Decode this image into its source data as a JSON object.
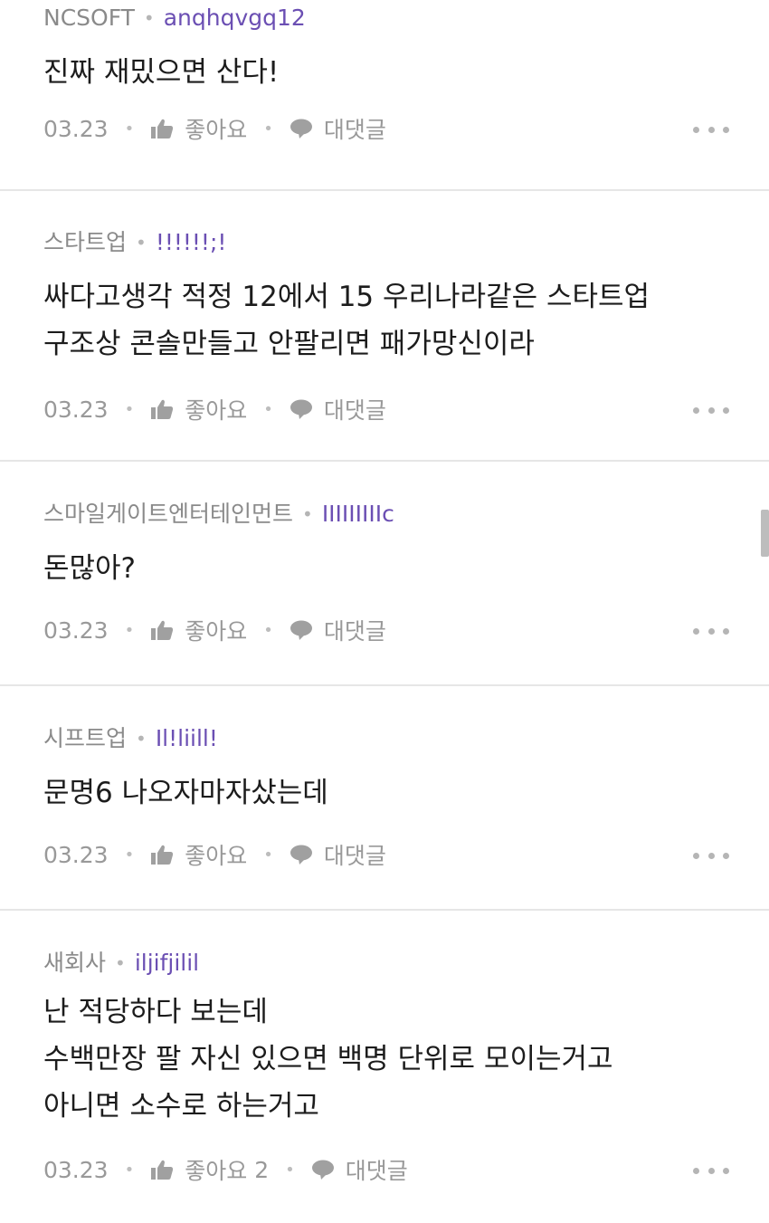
{
  "colors": {
    "nickname": "#6b4fb3",
    "meta": "#8a8a8a",
    "action": "#999999",
    "divider": "#e6e6e6"
  },
  "actions": {
    "like_label": "좋아요",
    "reply_label": "대댓글",
    "like_icon": "thumbs-up-icon",
    "reply_icon": "speech-bubble-icon",
    "more_icon": "more-dots-icon"
  },
  "comments": [
    {
      "company": "NCSOFT",
      "nickname": "anqhqvgq12",
      "lines": [
        "진짜 재밌으면 산다!"
      ],
      "date": "03.23",
      "like_count": ""
    },
    {
      "company": "스타트업",
      "nickname": "!!!!!!;!",
      "lines": [
        "싸다고생각 적정 12에서 15  우리나라같은 스타트업",
        "구조상 콘솔만들고 안팔리면 패가망신이라"
      ],
      "date": "03.23",
      "like_count": ""
    },
    {
      "company": "스마일게이트엔터테인먼트",
      "nickname": "IIIIIIIIIc",
      "lines": [
        "돈많아?"
      ],
      "date": "03.23",
      "like_count": ""
    },
    {
      "company": "시프트업",
      "nickname": "Il!liill!",
      "lines": [
        "문명6 나오자마자샀는데"
      ],
      "date": "03.23",
      "like_count": ""
    },
    {
      "company": "새회사",
      "nickname": "iljifjilil",
      "lines": [
        "난 적당하다 보는데",
        "수백만장 팔 자신 있으면 백명 단위로 모이는거고",
        "아니면 소수로 하는거고"
      ],
      "date": "03.23",
      "like_count": "2"
    }
  ]
}
